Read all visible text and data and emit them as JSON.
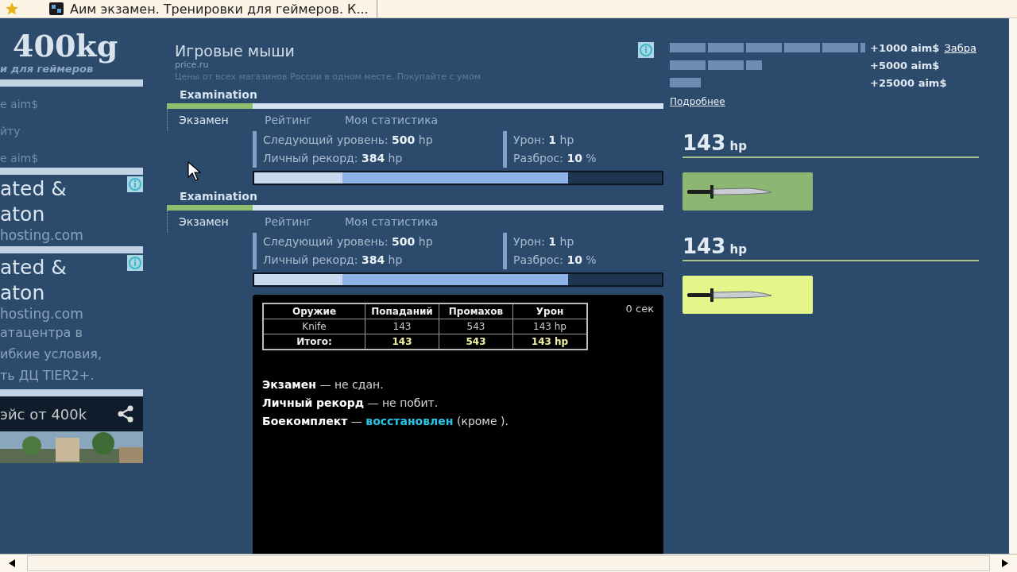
{
  "browser_tab": {
    "title": "Аим экзамен. Тренировки для геймеров. К..."
  },
  "sidebar": {
    "logo": "400kg",
    "tagline": "и для геймеров",
    "links": [
      "e aim$",
      "йту",
      "e aim$"
    ],
    "ads": [
      {
        "headline": [
          "ated &",
          "aton"
        ],
        "domain": "hosting.com"
      },
      {
        "headline": [
          "ated &",
          "aton"
        ],
        "domain": "hosting.com",
        "body": [
          "атацентра в",
          "ибкие условия,",
          "ть ДЦ TIER2+."
        ]
      }
    ],
    "promo": {
      "text": "эйс от 400k"
    }
  },
  "header": {
    "title": "Игровые мыши",
    "ad_domain": "price.ru",
    "ad_text": "Цены от всех магазинов России в одном месте. Покупайте с умом"
  },
  "sections": [
    {
      "label": "Examination",
      "tabs": [
        {
          "label": "Экзамен",
          "selected": true
        },
        {
          "label": "Рейтинг",
          "selected": false
        },
        {
          "label": "Моя статистика",
          "selected": false
        }
      ],
      "stat_groups": [
        {
          "items": [
            {
              "label": "Следующий уровень:",
              "value": "500",
              "unit": "hp"
            },
            {
              "label": "Личный рекорд:",
              "value": "384",
              "unit": "hp"
            }
          ]
        },
        {
          "items": [
            {
              "label": "Урон:",
              "value": "1",
              "unit": "hp"
            },
            {
              "label": "Разброс:",
              "value": "10",
              "unit": "%"
            }
          ]
        }
      ],
      "progress": {
        "level": 0.77
      }
    },
    {
      "label": "Examination",
      "tabs": [
        {
          "label": "Экзамен",
          "selected": true
        },
        {
          "label": "Рейтинг",
          "selected": false
        },
        {
          "label": "Моя статистика",
          "selected": false
        }
      ],
      "stat_groups": [
        {
          "items": [
            {
              "label": "Следующий уровень:",
              "value": "500",
              "unit": "hp"
            },
            {
              "label": "Личный рекорд:",
              "value": "384",
              "unit": "hp"
            }
          ]
        },
        {
          "items": [
            {
              "label": "Урон:",
              "value": "1",
              "unit": "hp"
            },
            {
              "label": "Разброс:",
              "value": "10",
              "unit": "%"
            }
          ]
        }
      ],
      "progress": {
        "level": 0.77
      }
    }
  ],
  "results": {
    "timer": "0 сек",
    "table": {
      "columns": [
        "Оружие",
        "Попаданий",
        "Промахов",
        "Урон"
      ],
      "rows": [
        {
          "kind": "item",
          "cells": [
            "Knife",
            "143",
            "543",
            "143 hp"
          ]
        },
        {
          "kind": "total",
          "cells": [
            "Итого:",
            "143",
            "543",
            "143 hp"
          ]
        }
      ]
    },
    "messages": [
      {
        "label": "Экзамен",
        "text": " — не сдан."
      },
      {
        "label": "Личный рекорд",
        "text": " — не побит."
      },
      {
        "label": "Боекомплект",
        "text": " — ",
        "status": "восстановлен",
        "rest": " (кроме )."
      }
    ]
  },
  "rewards": {
    "items": [
      {
        "amount": "+1000 aim$"
      },
      {
        "amount": "+5000 aim$"
      },
      {
        "amount": "+25000 aim$"
      }
    ],
    "claim_link": "Забра",
    "more_link": "Подробнее"
  },
  "weapons": [
    {
      "damage": "143",
      "unit": "hp",
      "highlighted": false
    },
    {
      "damage": "143",
      "unit": "hp",
      "highlighted": true
    }
  ]
}
